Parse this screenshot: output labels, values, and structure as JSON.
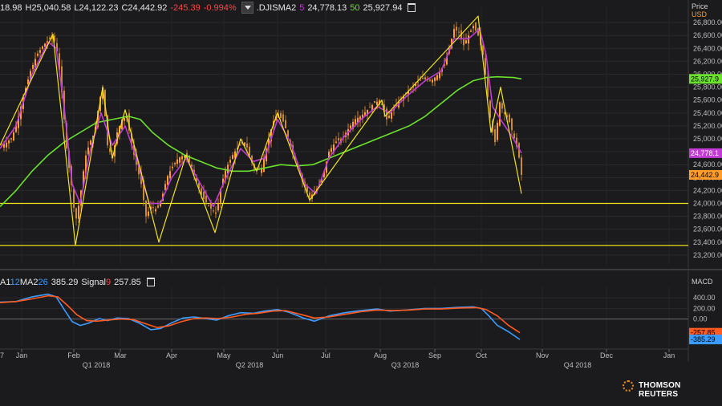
{
  "header": {
    "price_prefix": "18.98",
    "high": "H25,040.58",
    "low": "L24,122.23",
    "close": "C24,442.92",
    "change": "-245.39",
    "change_pct": "-0.994%",
    "sma_symbol": ".DJISMA2",
    "sma_short_period": "5",
    "sma_short_value": "24,778.13",
    "sma_long_period": "50",
    "sma_long_value": "25,927.94"
  },
  "price_axis": {
    "title": "Price",
    "currency": "USD"
  },
  "price_badges": {
    "sma50": "25,927.9",
    "sma5": "24,778.1",
    "close": "24,442.9"
  },
  "macd_header": {
    "ma_label": "A1",
    "ma_period1": "12",
    "ma_label2": "MA2",
    "ma_period2": "26",
    "macd_value": "385.29",
    "signal_label": "Signal",
    "signal_period": "9",
    "signal_value": "257.85",
    "panel_title": "MACD"
  },
  "macd_badges": {
    "signal": "-257.85",
    "macd": "-385.29"
  },
  "brand": "THOMSON REUTERS",
  "colors": {
    "background": "#1b1b1d",
    "up": "#ff9c2a",
    "down": "#c98b3a",
    "sma_short": "#c23bd4",
    "sma_long": "#6be22c",
    "trendline": "#f2e21c",
    "macd": "#3b9cff",
    "signal": "#ff5a1f"
  },
  "chart_data": [
    {
      "type": "line",
      "name": "price",
      "y_ticks": [
        23200,
        23400,
        23600,
        23800,
        24000,
        24200,
        24400,
        24600,
        24800,
        25000,
        25200,
        25400,
        25600,
        25800,
        26000,
        26200,
        26400,
        26600,
        26800
      ],
      "y_tick_labels": [
        "23,200.00",
        "23,400.00",
        "23,600.00",
        "23,800.00",
        "24,000.00",
        "24,200.00",
        "24,400.00",
        "24,600.00",
        "24,800.00",
        "25,000.00",
        "25,200.00",
        "25,400.00",
        "25,600.00",
        "25,800.00",
        "26,000.00",
        "26,200.00",
        "26,400.00",
        "26,600.00",
        "26,800.00"
      ],
      "ylim": [
        23050,
        27050
      ],
      "x_months": [
        "Jan",
        "Feb",
        "Mar",
        "Apr",
        "May",
        "Jun",
        "Jul",
        "Aug",
        "Sep",
        "Oct",
        "Nov",
        "Dec",
        "Jan"
      ],
      "x_quarters": [
        "Q1 2018",
        "Q2 2018",
        "Q3 2018",
        "Q4 2018"
      ],
      "x_start_label": "7",
      "horizontal_lines": [
        24000,
        23350
      ],
      "price_path": [
        [
          0,
          24880
        ],
        [
          8,
          24940
        ],
        [
          15,
          25020
        ],
        [
          22,
          25300
        ],
        [
          30,
          25700
        ],
        [
          38,
          26050
        ],
        [
          46,
          26300
        ],
        [
          54,
          26450
        ],
        [
          62,
          26550
        ],
        [
          66,
          26620
        ],
        [
          72,
          26300
        ],
        [
          78,
          25600
        ],
        [
          84,
          24700
        ],
        [
          88,
          24400
        ],
        [
          94,
          23700
        ],
        [
          100,
          24100
        ],
        [
          106,
          24700
        ],
        [
          112,
          24950
        ],
        [
          118,
          25100
        ],
        [
          124,
          25600
        ],
        [
          128,
          25800
        ],
        [
          134,
          24900
        ],
        [
          140,
          24700
        ],
        [
          146,
          25100
        ],
        [
          152,
          25300
        ],
        [
          158,
          25350
        ],
        [
          164,
          24900
        ],
        [
          170,
          24600
        ],
        [
          176,
          24300
        ],
        [
          182,
          23800
        ],
        [
          188,
          23950
        ],
        [
          196,
          23900
        ],
        [
          202,
          24100
        ],
        [
          208,
          24400
        ],
        [
          214,
          24550
        ],
        [
          222,
          24700
        ],
        [
          230,
          24750
        ],
        [
          238,
          24600
        ],
        [
          246,
          24300
        ],
        [
          252,
          24100
        ],
        [
          258,
          24000
        ],
        [
          264,
          23900
        ],
        [
          270,
          23850
        ],
        [
          276,
          24300
        ],
        [
          282,
          24550
        ],
        [
          290,
          24750
        ],
        [
          298,
          24900
        ],
        [
          306,
          24950
        ],
        [
          312,
          24700
        ],
        [
          318,
          24500
        ],
        [
          326,
          24550
        ],
        [
          334,
          24950
        ],
        [
          340,
          25250
        ],
        [
          346,
          25400
        ],
        [
          354,
          25250
        ],
        [
          362,
          24900
        ],
        [
          370,
          24600
        ],
        [
          378,
          24300
        ],
        [
          386,
          24100
        ],
        [
          394,
          24200
        ],
        [
          402,
          24400
        ],
        [
          410,
          24800
        ],
        [
          418,
          24950
        ],
        [
          426,
          25000
        ],
        [
          434,
          25150
        ],
        [
          442,
          25300
        ],
        [
          450,
          25350
        ],
        [
          458,
          25450
        ],
        [
          466,
          25550
        ],
        [
          474,
          25600
        ],
        [
          482,
          25300
        ],
        [
          490,
          25450
        ],
        [
          498,
          25600
        ],
        [
          506,
          25700
        ],
        [
          514,
          25800
        ],
        [
          522,
          25900
        ],
        [
          530,
          25950
        ],
        [
          538,
          25900
        ],
        [
          546,
          26000
        ],
        [
          554,
          26150
        ],
        [
          560,
          26400
        ],
        [
          566,
          26700
        ],
        [
          572,
          26650
        ],
        [
          578,
          26450
        ],
        [
          584,
          26600
        ],
        [
          590,
          26750
        ],
        [
          596,
          26600
        ],
        [
          602,
          26300
        ],
        [
          606,
          25900
        ],
        [
          610,
          25400
        ],
        [
          614,
          25100
        ],
        [
          618,
          24900
        ],
        [
          622,
          25600
        ],
        [
          628,
          25400
        ],
        [
          634,
          25300
        ],
        [
          640,
          25050
        ],
        [
          646,
          24800
        ],
        [
          650,
          24442
        ]
      ],
      "sma5": [
        [
          0,
          24850
        ],
        [
          20,
          25200
        ],
        [
          40,
          26000
        ],
        [
          60,
          26500
        ],
        [
          70,
          26400
        ],
        [
          80,
          25500
        ],
        [
          90,
          24300
        ],
        [
          100,
          24000
        ],
        [
          112,
          24800
        ],
        [
          126,
          25400
        ],
        [
          140,
          24900
        ],
        [
          156,
          25200
        ],
        [
          170,
          24700
        ],
        [
          186,
          24000
        ],
        [
          200,
          24000
        ],
        [
          214,
          24400
        ],
        [
          232,
          24700
        ],
        [
          250,
          24300
        ],
        [
          266,
          23950
        ],
        [
          280,
          24350
        ],
        [
          300,
          24850
        ],
        [
          316,
          24650
        ],
        [
          330,
          24700
        ],
        [
          346,
          25300
        ],
        [
          362,
          24950
        ],
        [
          380,
          24300
        ],
        [
          394,
          24150
        ],
        [
          410,
          24700
        ],
        [
          430,
          25050
        ],
        [
          450,
          25300
        ],
        [
          470,
          25500
        ],
        [
          486,
          25400
        ],
        [
          506,
          25650
        ],
        [
          530,
          25900
        ],
        [
          550,
          26050
        ],
        [
          566,
          26550
        ],
        [
          584,
          26550
        ],
        [
          598,
          26700
        ],
        [
          606,
          26300
        ],
        [
          614,
          25500
        ],
        [
          624,
          25300
        ],
        [
          640,
          25000
        ],
        [
          650,
          24778
        ]
      ],
      "sma50": [
        [
          0,
          23950
        ],
        [
          20,
          24200
        ],
        [
          40,
          24500
        ],
        [
          60,
          24750
        ],
        [
          80,
          24950
        ],
        [
          100,
          25100
        ],
        [
          120,
          25250
        ],
        [
          140,
          25300
        ],
        [
          160,
          25350
        ],
        [
          175,
          25300
        ],
        [
          190,
          25100
        ],
        [
          210,
          24900
        ],
        [
          230,
          24750
        ],
        [
          250,
          24650
        ],
        [
          270,
          24550
        ],
        [
          290,
          24500
        ],
        [
          310,
          24500
        ],
        [
          330,
          24550
        ],
        [
          350,
          24600
        ],
        [
          370,
          24580
        ],
        [
          390,
          24600
        ],
        [
          410,
          24700
        ],
        [
          430,
          24800
        ],
        [
          450,
          24900
        ],
        [
          470,
          25000
        ],
        [
          490,
          25100
        ],
        [
          510,
          25200
        ],
        [
          530,
          25350
        ],
        [
          550,
          25550
        ],
        [
          570,
          25750
        ],
        [
          590,
          25900
        ],
        [
          606,
          25950
        ],
        [
          620,
          25960
        ],
        [
          640,
          25950
        ],
        [
          650,
          25928
        ]
      ],
      "zigzag": [
        [
          0,
          24900
        ],
        [
          66,
          26620
        ],
        [
          94,
          23350
        ],
        [
          128,
          25800
        ],
        [
          140,
          24700
        ],
        [
          156,
          25450
        ],
        [
          198,
          23400
        ],
        [
          232,
          24750
        ],
        [
          268,
          23550
        ],
        [
          300,
          25000
        ],
        [
          320,
          24500
        ],
        [
          346,
          25400
        ],
        [
          386,
          24050
        ],
        [
          476,
          25600
        ],
        [
          480,
          25350
        ],
        [
          596,
          26900
        ],
        [
          612,
          25100
        ],
        [
          624,
          25800
        ],
        [
          650,
          24150
        ]
      ]
    },
    {
      "type": "line",
      "name": "MACD",
      "y_ticks": [
        0,
        200,
        400
      ],
      "y_tick_labels": [
        "0.00",
        "200.00",
        "400.00"
      ],
      "ylim": [
        -520,
        600
      ],
      "series": [
        {
          "name": "MA1 12 MA2 26",
          "values": [
            [
              0,
              320
            ],
            [
              20,
              330
            ],
            [
              40,
              420
            ],
            [
              60,
              470
            ],
            [
              70,
              420
            ],
            [
              80,
              180
            ],
            [
              90,
              -50
            ],
            [
              100,
              -120
            ],
            [
              110,
              -80
            ],
            [
              124,
              10
            ],
            [
              134,
              -30
            ],
            [
              146,
              20
            ],
            [
              160,
              10
            ],
            [
              174,
              -80
            ],
            [
              188,
              -200
            ],
            [
              200,
              -180
            ],
            [
              214,
              -70
            ],
            [
              228,
              20
            ],
            [
              242,
              40
            ],
            [
              256,
              10
            ],
            [
              270,
              -20
            ],
            [
              284,
              60
            ],
            [
              300,
              120
            ],
            [
              316,
              110
            ],
            [
              330,
              150
            ],
            [
              346,
              180
            ],
            [
              360,
              130
            ],
            [
              378,
              20
            ],
            [
              392,
              -40
            ],
            [
              410,
              60
            ],
            [
              430,
              120
            ],
            [
              450,
              160
            ],
            [
              470,
              190
            ],
            [
              486,
              150
            ],
            [
              506,
              170
            ],
            [
              530,
              200
            ],
            [
              550,
              200
            ],
            [
              570,
              220
            ],
            [
              590,
              230
            ],
            [
              600,
              200
            ],
            [
              610,
              50
            ],
            [
              620,
              -120
            ],
            [
              634,
              -240
            ],
            [
              648,
              -385
            ]
          ]
        },
        {
          "name": "Signal 9",
          "values": [
            [
              0,
              310
            ],
            [
              20,
              330
            ],
            [
              40,
              380
            ],
            [
              60,
              440
            ],
            [
              72,
              420
            ],
            [
              84,
              260
            ],
            [
              96,
              80
            ],
            [
              108,
              -30
            ],
            [
              120,
              -40
            ],
            [
              134,
              -20
            ],
            [
              150,
              0
            ],
            [
              166,
              -10
            ],
            [
              182,
              -90
            ],
            [
              196,
              -160
            ],
            [
              210,
              -130
            ],
            [
              226,
              -50
            ],
            [
              242,
              10
            ],
            [
              256,
              20
            ],
            [
              272,
              10
            ],
            [
              290,
              40
            ],
            [
              306,
              90
            ],
            [
              322,
              110
            ],
            [
              340,
              150
            ],
            [
              356,
              160
            ],
            [
              374,
              90
            ],
            [
              392,
              20
            ],
            [
              410,
              40
            ],
            [
              430,
              90
            ],
            [
              450,
              140
            ],
            [
              470,
              170
            ],
            [
              490,
              160
            ],
            [
              510,
              170
            ],
            [
              530,
              190
            ],
            [
              550,
              190
            ],
            [
              574,
              210
            ],
            [
              594,
              215
            ],
            [
              606,
              180
            ],
            [
              620,
              60
            ],
            [
              634,
              -120
            ],
            [
              648,
              -258
            ]
          ]
        }
      ]
    }
  ]
}
